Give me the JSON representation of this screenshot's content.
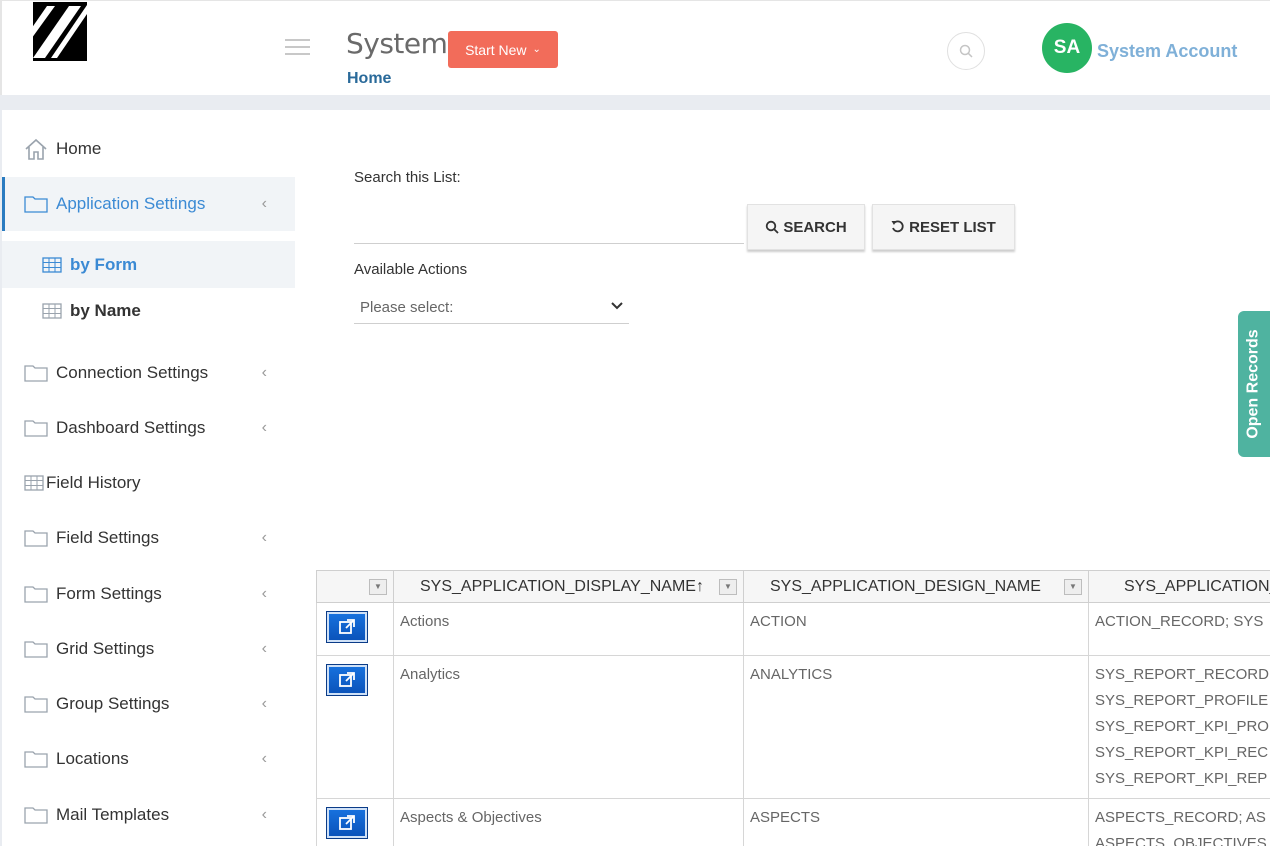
{
  "header": {
    "title": "System",
    "start_new": "Start New",
    "breadcrumb_home": "Home",
    "avatar_initials": "SA",
    "account_name": "System Account"
  },
  "sidebar": {
    "items": [
      {
        "label": "Home"
      },
      {
        "label": "Application Settings"
      },
      {
        "label": "by Form"
      },
      {
        "label": "by Name"
      },
      {
        "label": "Connection Settings"
      },
      {
        "label": "Dashboard Settings"
      },
      {
        "label": "Field History"
      },
      {
        "label": "Field Settings"
      },
      {
        "label": "Form Settings"
      },
      {
        "label": "Grid Settings"
      },
      {
        "label": "Group Settings"
      },
      {
        "label": "Locations"
      },
      {
        "label": "Mail Templates"
      }
    ]
  },
  "search": {
    "label": "Search this List:",
    "value": "",
    "search_button": "SEARCH",
    "reset_button": "RESET LIST"
  },
  "actions": {
    "label": "Available Actions",
    "selected": "Please select:"
  },
  "open_records": "Open Records",
  "grid": {
    "columns": [
      "SYS_APPLICATION_DISPLAY_NAME",
      "SYS_APPLICATION_DESIGN_NAME",
      "SYS_APPLICATION_"
    ],
    "sort_indicator": "↑",
    "rows": [
      {
        "display": "Actions",
        "design": "ACTION",
        "forms": [
          "ACTION_RECORD; SYS"
        ]
      },
      {
        "display": "Analytics",
        "design": "ANALYTICS",
        "forms": [
          "SYS_REPORT_RECORD",
          "SYS_REPORT_PROFILE",
          "SYS_REPORT_KPI_PRO",
          "SYS_REPORT_KPI_REC",
          "SYS_REPORT_KPI_REP"
        ]
      },
      {
        "display": "Aspects & Objectives",
        "design": "ASPECTS",
        "forms": [
          "ASPECTS_RECORD; AS",
          "ASPECTS_OBJECTIVES"
        ]
      }
    ]
  },
  "colors": {
    "start_new_bg": "#f26c5a",
    "avatar_bg": "#28b463",
    "active_blue": "#3b8ad4",
    "open_records_bg": "#4fb3a0"
  }
}
